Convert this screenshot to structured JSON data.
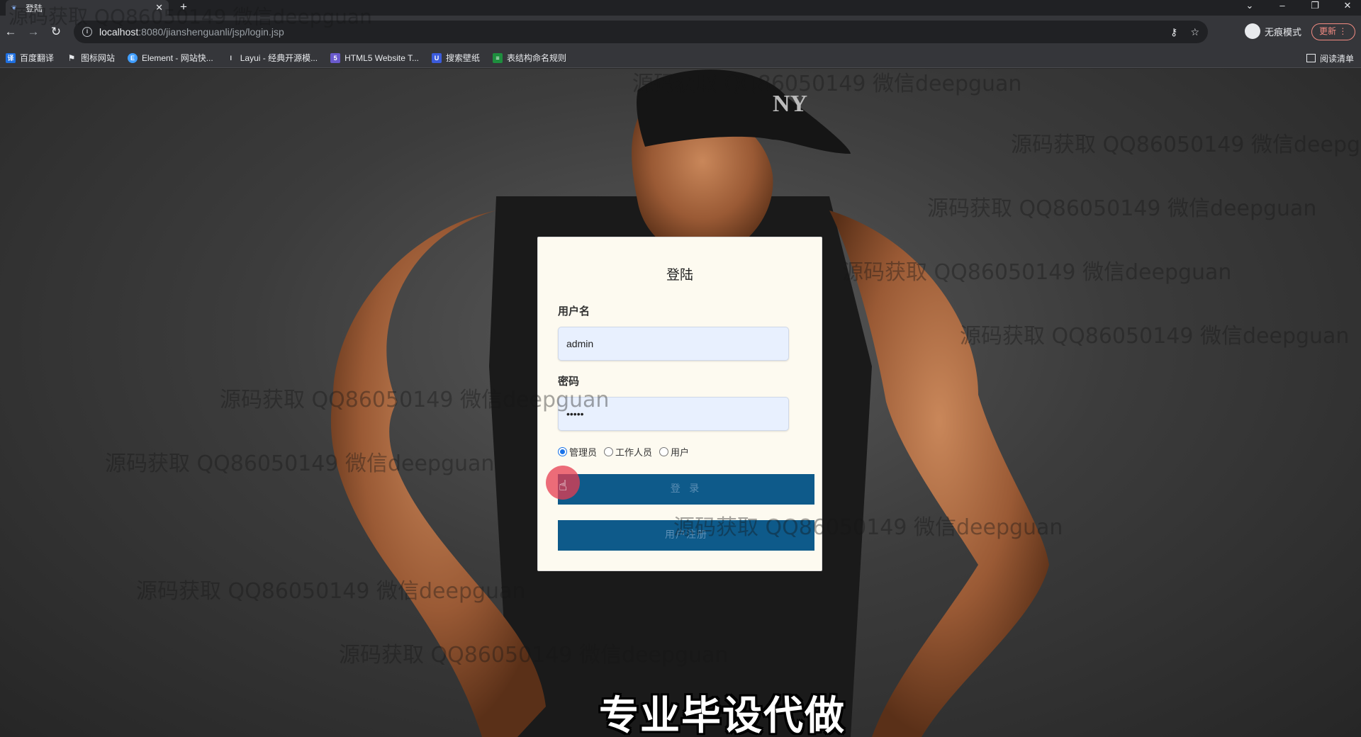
{
  "browser": {
    "tab_title": "登陆",
    "tab_favicon": "leaf",
    "url_host": "localhost",
    "url_path": ":8080/jianshenguanli/jsp/login.jsp",
    "incognito_label": "无痕模式",
    "update_label": "更新",
    "bookmarks": [
      {
        "label": "百度翻译",
        "icon": "translate-icon",
        "color": "#1e6fe0"
      },
      {
        "label": "图标网站",
        "icon": "flag-icon",
        "color": "#444444"
      },
      {
        "label": "Element - 网站快...",
        "icon": "element-icon",
        "color": "#409eff"
      },
      {
        "label": "Layui - 经典开源模...",
        "icon": "layui-icon",
        "color": "#555555"
      },
      {
        "label": "HTML5 Website T...",
        "icon": "html5-icon",
        "color": "#6a5acd"
      },
      {
        "label": "搜索壁纸",
        "icon": "wallpaper-icon",
        "color": "#3b5bdb"
      },
      {
        "label": "表结构命名规则",
        "icon": "sheet-icon",
        "color": "#1e8e3e"
      }
    ],
    "reading_list_label": "阅读清单"
  },
  "login": {
    "title": "登陆",
    "username_label": "用户名",
    "username_value": "admin",
    "password_label": "密码",
    "password_value": "•••••",
    "roles": [
      {
        "label": "管理员",
        "checked": true
      },
      {
        "label": "工作人员",
        "checked": false
      },
      {
        "label": "用户",
        "checked": false
      }
    ],
    "login_button": "登 录",
    "register_button": "用户注册"
  },
  "watermark_text": "源码获取 QQ86050149 微信deepguan",
  "caption": "专业毕设代做",
  "colors": {
    "button": "#0e5a8a",
    "card": "#fdfaf0",
    "input": "#e8f0fe",
    "update": "#f28b82"
  }
}
